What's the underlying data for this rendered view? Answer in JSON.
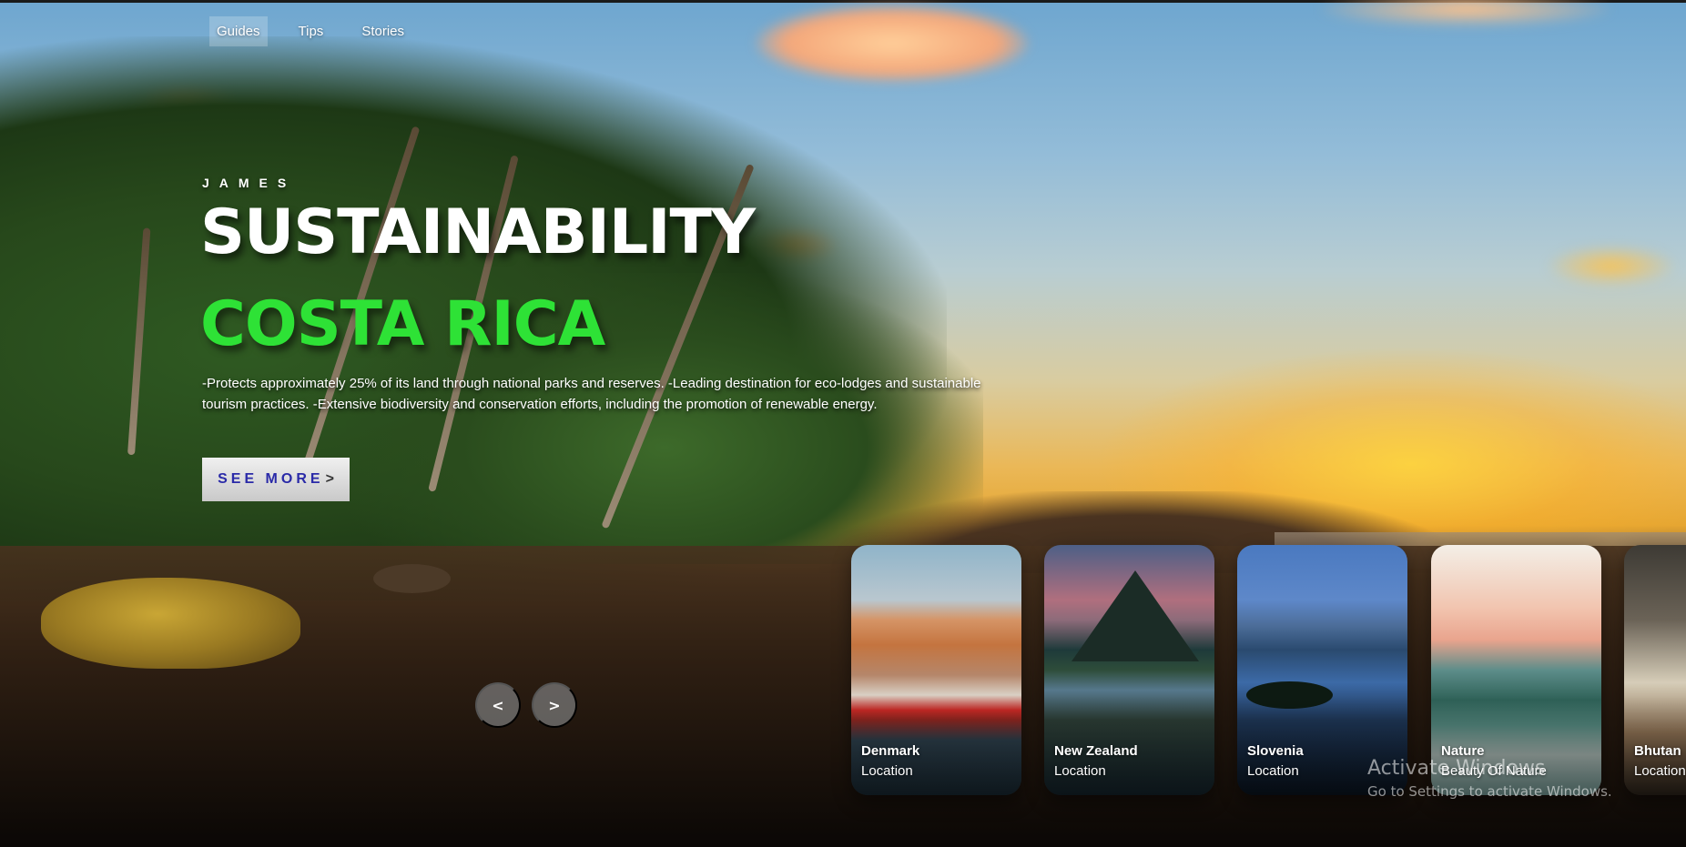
{
  "nav": {
    "items": [
      {
        "label": "Guides",
        "active": true
      },
      {
        "label": "Tips",
        "active": false
      },
      {
        "label": "Stories",
        "active": false
      }
    ]
  },
  "hero": {
    "author": "JAMES",
    "title": "SUSTAINABILITY",
    "topic": "COSTA RICA",
    "topic_color": "#2ee236",
    "description": "-Protects approximately 25% of its land through national parks and reserves. -Leading destination for eco-lodges and sustainable tourism practices. -Extensive biodiversity and conservation efforts, including the promotion of renewable energy.",
    "cta_label": "SEE MORE",
    "cta_icon": ">"
  },
  "slider": {
    "prev_icon": "<",
    "next_icon": ">"
  },
  "cards": [
    {
      "name": "Denmark",
      "sub": "Location"
    },
    {
      "name": "New Zealand",
      "sub": "Location"
    },
    {
      "name": "Slovenia",
      "sub": "Location"
    },
    {
      "name": "Nature",
      "sub": "Beauty Of Nature"
    },
    {
      "name": "Bhutan",
      "sub": "Location"
    }
  ],
  "watermark": {
    "title": "Activate Windows",
    "subtitle": "Go to Settings to activate Windows."
  }
}
